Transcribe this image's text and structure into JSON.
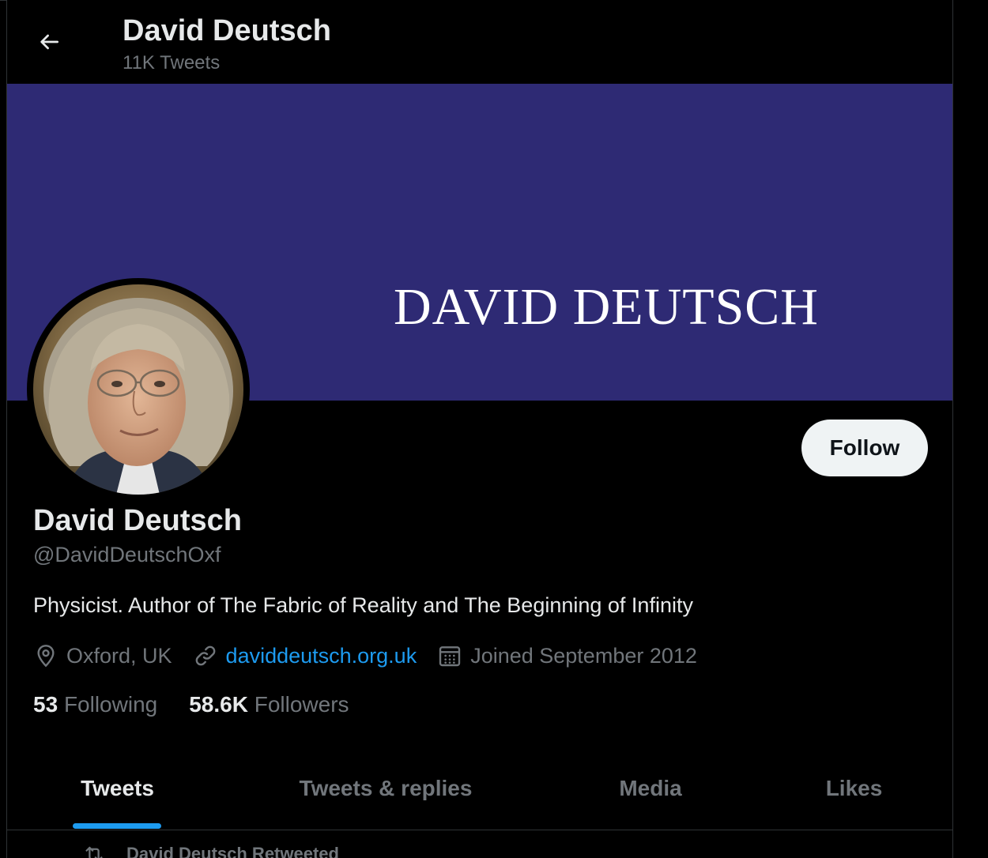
{
  "header": {
    "title": "David Deutsch",
    "tweet_count": "11K Tweets",
    "back_icon": "arrow-left-icon"
  },
  "banner": {
    "text": "DAVID DEUTSCH",
    "color": "#2e2a74"
  },
  "profile": {
    "name": "David Deutsch",
    "handle": "@DavidDeutschOxf",
    "bio": "Physicist. Author of The Fabric of Reality and The Beginning of Infinity",
    "follow_label": "Follow",
    "location": "Oxford, UK",
    "website": "daviddeutsch.org.uk",
    "joined": "Joined September 2012",
    "following_count": "53",
    "following_label": "Following",
    "followers_count": "58.6K",
    "followers_label": "Followers"
  },
  "tabs": [
    {
      "label": "Tweets",
      "active": true
    },
    {
      "label": "Tweets & replies",
      "active": false
    },
    {
      "label": "Media",
      "active": false
    },
    {
      "label": "Likes",
      "active": false
    }
  ],
  "feed": {
    "retweet_label": "David Deutsch Retweeted"
  },
  "colors": {
    "accent": "#1d9bf0",
    "background": "#000000",
    "muted_text": "#71767b"
  }
}
